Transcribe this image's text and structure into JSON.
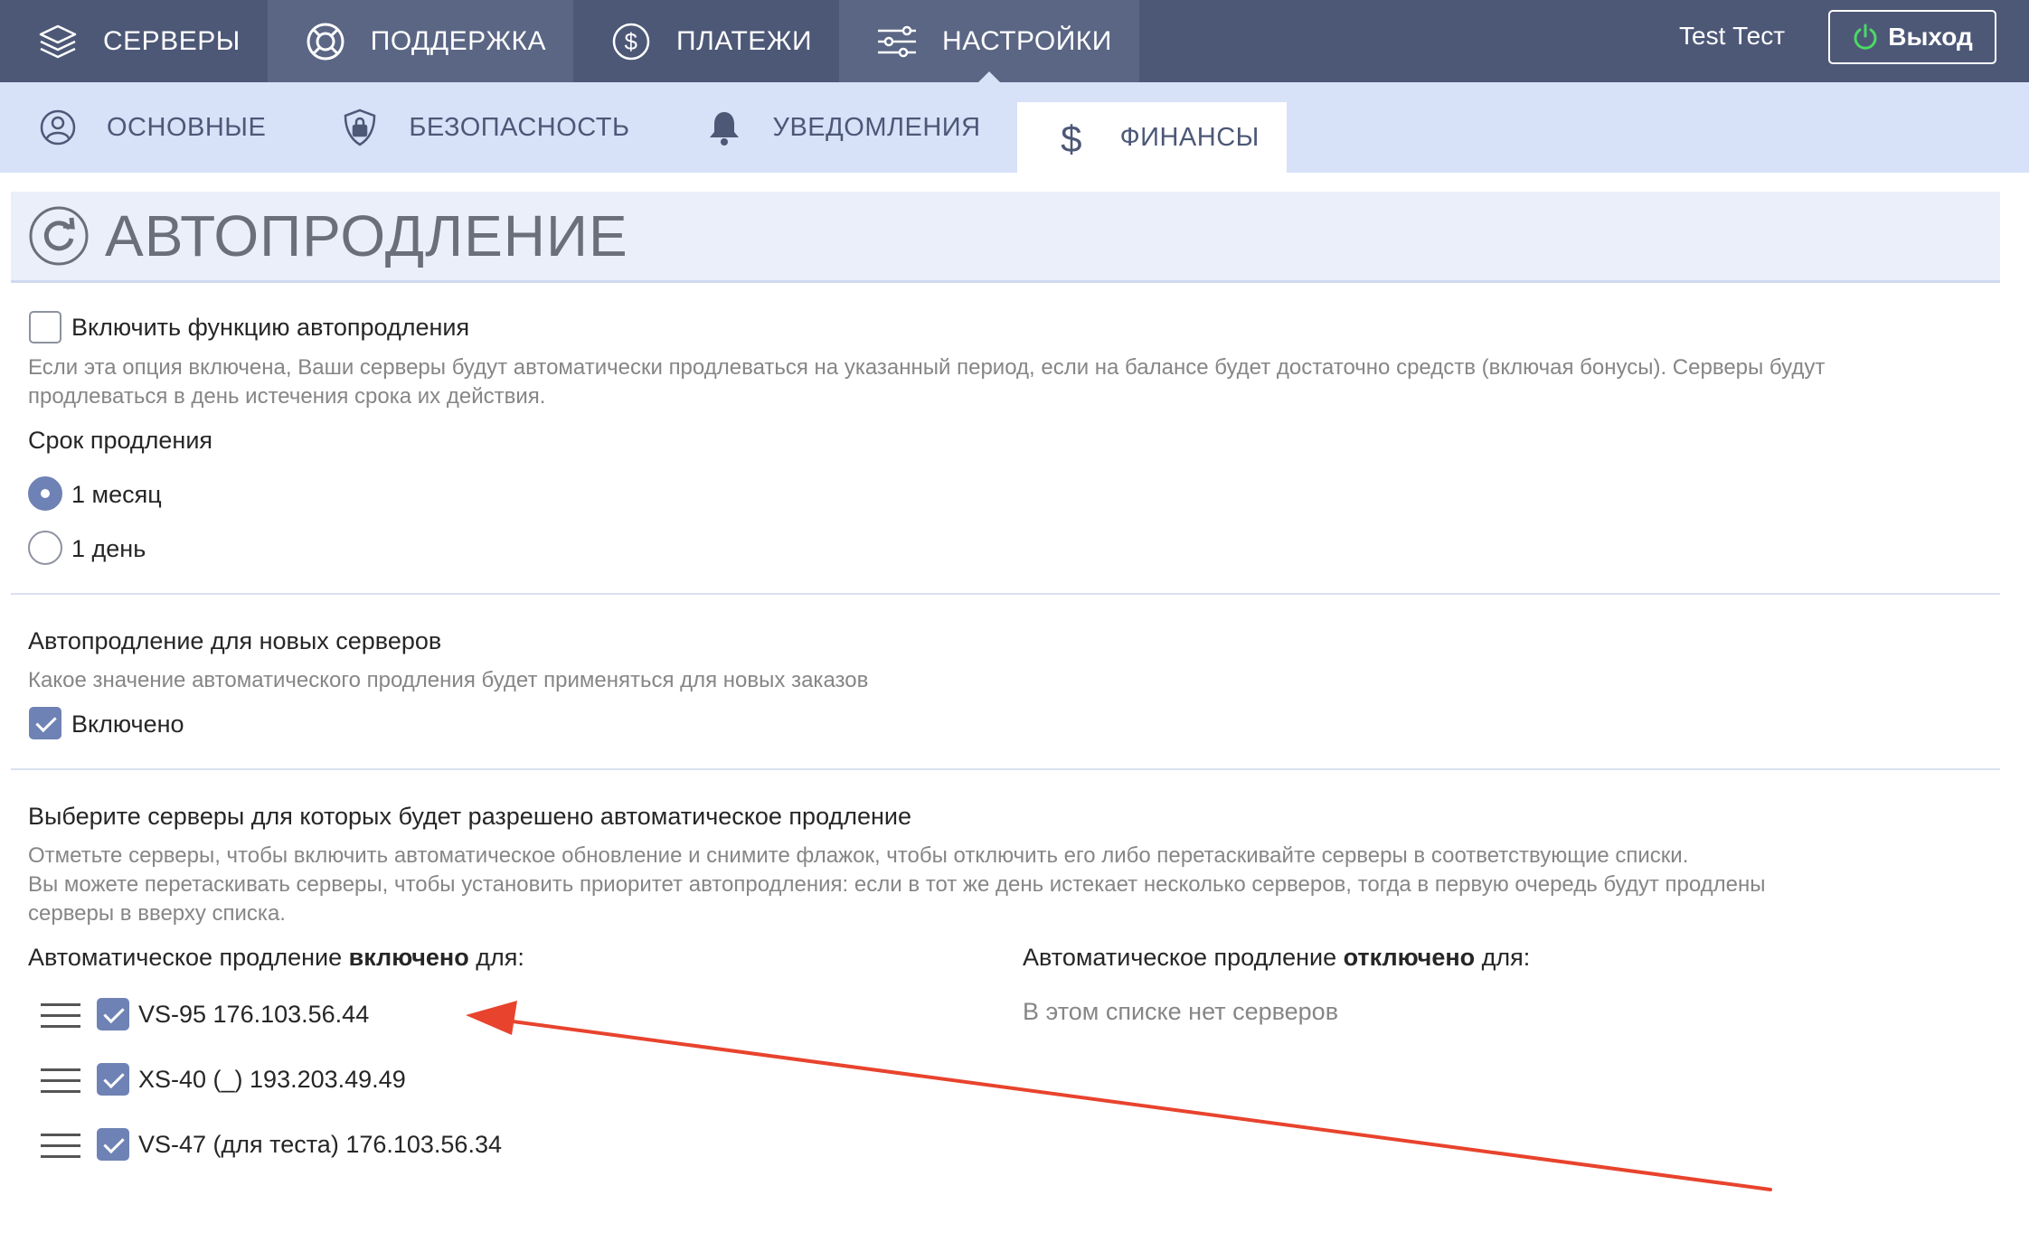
{
  "topnav": {
    "items": [
      {
        "label": "СЕРВЕРЫ",
        "icon": "layers-icon"
      },
      {
        "label": "ПОДДЕРЖКА",
        "icon": "lifebuoy-icon"
      },
      {
        "label": "ПЛАТЕЖИ",
        "icon": "dollar-circle-icon"
      },
      {
        "label": "НАСТРОЙКИ",
        "icon": "sliders-icon"
      }
    ],
    "user_name": "Test Тест",
    "logout_label": "Выход"
  },
  "subnav": {
    "items": [
      {
        "label": "ОСНОВНЫЕ",
        "icon": "user-circle-icon"
      },
      {
        "label": "БЕЗОПАСНОСТЬ",
        "icon": "shield-lock-icon"
      },
      {
        "label": "УВЕДОМЛЕНИЯ",
        "icon": "bell-icon"
      },
      {
        "label": "ФИНАНСЫ",
        "icon": "dollar-icon"
      }
    ]
  },
  "section": {
    "title": "АВТОПРОДЛЕНИЕ",
    "enable_label": "Включить функцию автопродления",
    "enable_hint_1": "Если эта опция включена, Ваши серверы будут автоматически продлеваться на указанный период, если на балансе будет достаточно средств (включая бонусы). Серверы будут",
    "enable_hint_2": "продлеваться в день истечения срока их действия.",
    "period_label": "Срок продления",
    "period_options": [
      "1 месяц",
      "1 день"
    ],
    "new_servers_label": "Автопродление для новых серверов",
    "new_servers_hint": "Какое значение автоматического продления будет применяться для новых заказов",
    "new_servers_checkbox": "Включено",
    "select_label": "Выберите серверы для которых будет разрешено автоматическое продление",
    "select_hint_1": "Отметьте серверы, чтобы включить автоматическое обновление и снимите флажок, чтобы отключить его либо перетаскивайте серверы в соответствующие списки.",
    "select_hint_2": "Вы можете перетаскивать серверы, чтобы установить приоритет автопродления: если в тот же день истекает несколько серверов, тогда в первую очередь будут продлены",
    "select_hint_3": "серверы в вверху списка.",
    "enabled_prefix": "Автоматическое продление ",
    "enabled_bold": "включено",
    "enabled_suffix": " для:",
    "disabled_prefix": "Автоматическое продление ",
    "disabled_bold": "отключено",
    "disabled_suffix": " для:",
    "enabled_servers": [
      "VS-95 176.103.56.44",
      "XS-40 (_) 193.203.49.49",
      "VS-47 (для теста) 176.103.56.34"
    ],
    "empty_list": "В этом списке нет серверов"
  },
  "colors": {
    "topbar": "#4d5877",
    "subbar": "#d7e1f7",
    "accent": "#6f82b5",
    "arrow": "#e8432d",
    "logout_icon": "#4cd964"
  }
}
